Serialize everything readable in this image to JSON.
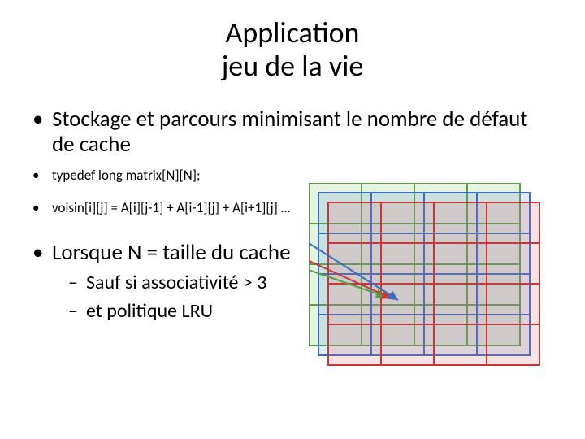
{
  "title_line1": "Application",
  "title_line2": "jeu de la vie",
  "bullet1": "Stockage et parcours minimisant le nombre de défaut de cache",
  "bullet2": "typedef long matrix[N][N];",
  "bullet3": "voisin[i][j] = A[i][j-1] + A[i-1][j] + A[i+1][j] …",
  "bullet4": "Lorsque N = taille du cache",
  "sub1": "Sauf si associativité > 3",
  "sub2": "et politique LRU"
}
